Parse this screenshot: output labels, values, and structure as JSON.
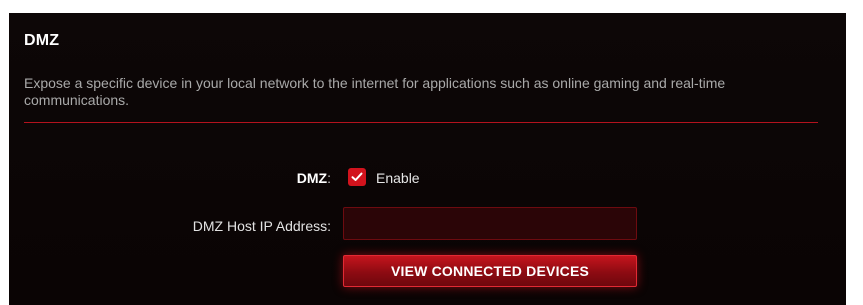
{
  "section": {
    "title": "DMZ",
    "description": "Expose a specific device in your local network to the internet for applications such as online gaming and real-time communications."
  },
  "form": {
    "dmz_label": "DMZ",
    "dmz_colon": ":",
    "enable_checked": true,
    "enable_label": "Enable",
    "host_ip_label": "DMZ Host IP Address:",
    "host_ip_value": "",
    "view_button_label": "VIEW CONNECTED DEVICES"
  },
  "colors": {
    "accent": "#d2131d",
    "panel_background": "#0c0606",
    "divider": "#b3121d"
  },
  "icons": {
    "checkbox_mark": "check-icon"
  }
}
